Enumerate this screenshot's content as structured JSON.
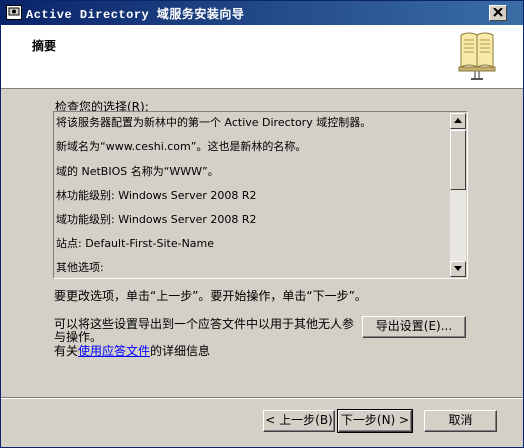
{
  "window": {
    "title": "Active Directory 域服务安装向导"
  },
  "header": {
    "title": "摘要",
    "book_icon": "book-icon"
  },
  "review": {
    "label": "检查您的选择(R):",
    "lines": [
      "将该服务器配置为新林中的第一个 Active Directory 域控制器。",
      "新域名为“www.ceshi.com”。这也是新林的名称。",
      "域的 NetBIOS 名称为“WWW”。",
      "林功能级别: Windows Server 2008 R2",
      "域功能级别: Windows Server 2008 R2",
      "站点: Default-First-Site-Name",
      "其他选项:"
    ]
  },
  "hint": "要更改选项，单击“上一步”。要开始操作，单击“下一步”。",
  "export": {
    "text": "可以将这些设置导出到一个应答文件中以用于其他无人参与操作。",
    "button": "导出设置(E)..."
  },
  "info": {
    "prefix": "有关",
    "link": "使用应答文件",
    "suffix": "的详细信息"
  },
  "buttons": {
    "back": "< 上一步(B)",
    "next": "下一步(N) >",
    "cancel": "取消"
  }
}
